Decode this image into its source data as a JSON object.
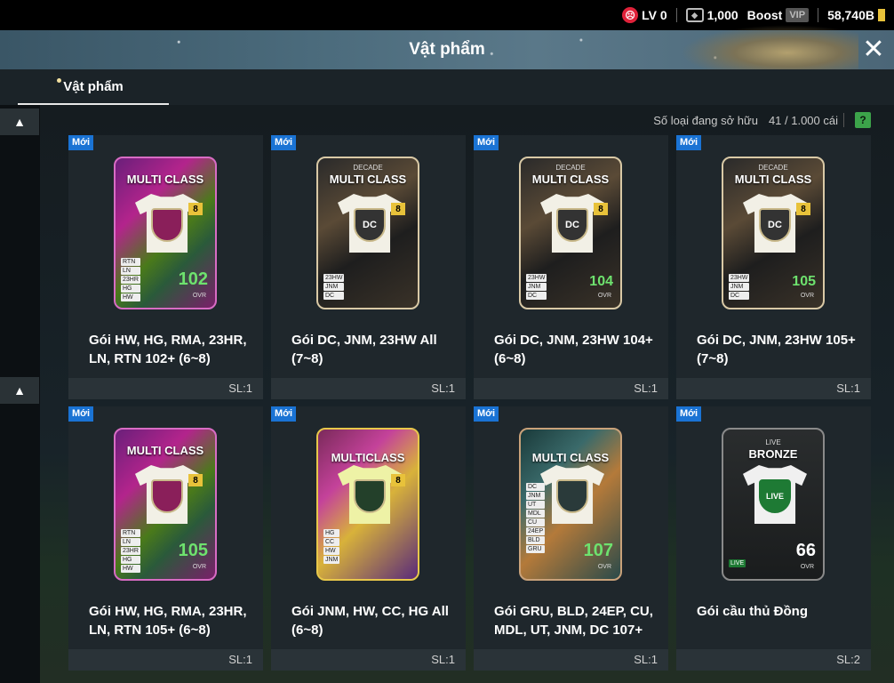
{
  "status": {
    "level": "LV 0",
    "coins": "1,000",
    "boost": "Boost",
    "vip": "VIP",
    "bp": "58,740B"
  },
  "header": {
    "title": "Vật phẩm"
  },
  "tabs": [
    {
      "label": "Vật phẩm",
      "active": true
    }
  ],
  "inventory": {
    "label": "Số loại đang sở hữu",
    "count": "41 / 1.000 cái",
    "help": "?"
  },
  "items": [
    {
      "badge": "Mới",
      "card_title": "MULTI CLASS",
      "card_sub": "",
      "crest": "",
      "tags": [
        "RTN",
        "LN",
        "23HR",
        "",
        "HG",
        "HW"
      ],
      "ovr": "102",
      "name": "Gói HW, HG, RMA, 23HR, LN, RTN 102+ (6~8)",
      "qty": "SL:1"
    },
    {
      "badge": "Mới",
      "card_title": "MULTI CLASS",
      "card_sub": "DECADE",
      "crest": "DC",
      "tags": [
        "23HW",
        "JNM",
        "DC"
      ],
      "ovr": "",
      "name": "Gói DC, JNM, 23HW All (7~8)",
      "qty": "SL:1"
    },
    {
      "badge": "Mới",
      "card_title": "MULTI CLASS",
      "card_sub": "DECADE",
      "crest": "DC",
      "tags": [
        "23HW",
        "JNM",
        "DC"
      ],
      "ovr": "104",
      "name": "Gói DC, JNM, 23HW 104+ (6~8)",
      "qty": "SL:1"
    },
    {
      "badge": "Mới",
      "card_title": "MULTI CLASS",
      "card_sub": "DECADE",
      "crest": "DC",
      "tags": [
        "23HW",
        "JNM",
        "DC"
      ],
      "ovr": "105",
      "name": "Gói DC, JNM, 23HW 105+ (7~8)",
      "qty": "SL:1"
    },
    {
      "badge": "Mới",
      "card_title": "MULTI CLASS",
      "card_sub": "",
      "crest": "",
      "tags": [
        "RTN",
        "LN",
        "23HR",
        "",
        "HG",
        "HW"
      ],
      "ovr": "105",
      "name": "Gói HW, HG, RMA, 23HR, LN, RTN 105+ (6~8)",
      "qty": "SL:1"
    },
    {
      "badge": "Mới",
      "card_title": "MULTICLASS",
      "card_sub": "",
      "crest": "",
      "tags": [
        "HG",
        "CC",
        "HW",
        "JNM"
      ],
      "ovr": "",
      "name": "Gói JNM, HW, CC, HG All (6~8)",
      "qty": "SL:1"
    },
    {
      "badge": "Mới",
      "card_title": "MULTI CLASS",
      "card_sub": "",
      "crest": "",
      "tags": [
        "DC",
        "JNM",
        "UT",
        "MDL",
        "CU",
        "24EP",
        "BLD",
        "GRU"
      ],
      "ovr": "107",
      "name": "Gói GRU, BLD, 24EP, CU, MDL, UT, JNM, DC 107+",
      "qty": "SL:1"
    },
    {
      "badge": "Mới",
      "card_title": "BRONZE",
      "card_sub": "LIVE",
      "crest": "LIVE",
      "tags": [
        "LIVE"
      ],
      "ovr": "66",
      "name": "Gói cầu thủ Đồng",
      "qty": "SL:2"
    }
  ]
}
